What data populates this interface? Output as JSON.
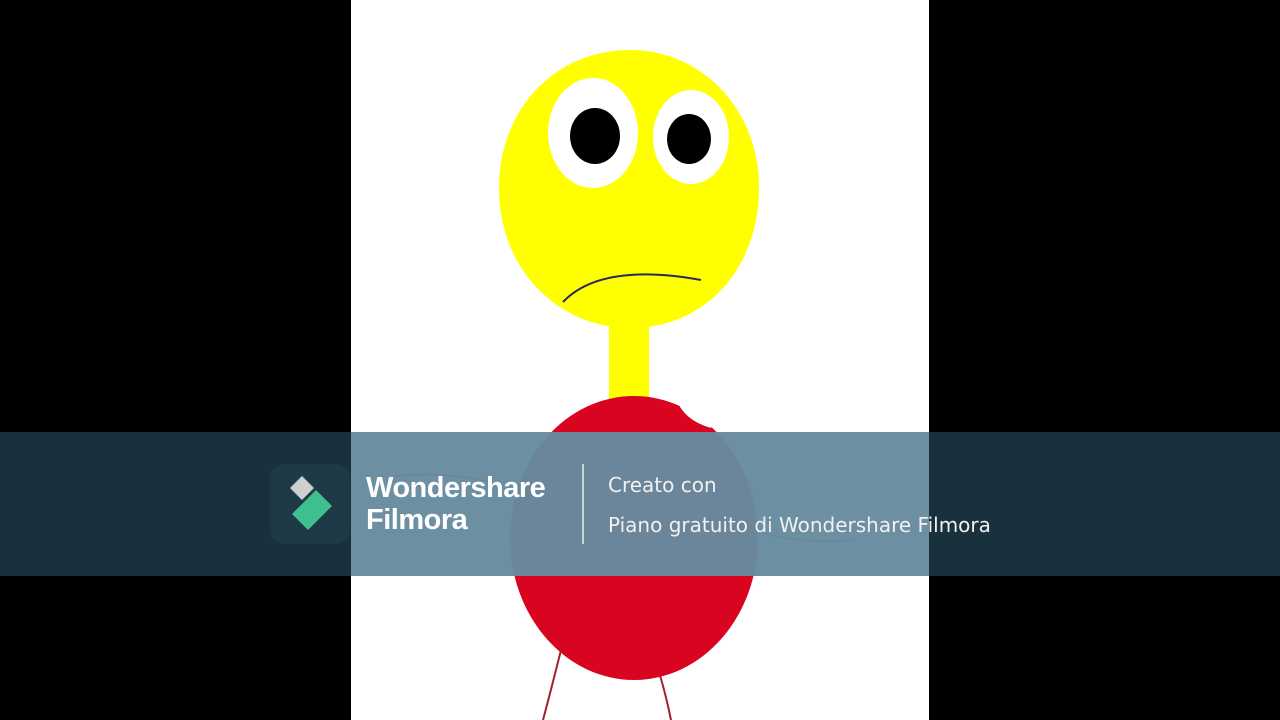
{
  "drawing": {
    "colors": {
      "background": "#000000",
      "paper": "#ffffff",
      "head": "#ffff00",
      "body": "#d90520",
      "eye_white": "#ffffff",
      "pupil": "#000000",
      "mouth": "#2a2a5a",
      "arms": "#55557a",
      "legs": "#a02030"
    },
    "expression": "sad"
  },
  "watermark": {
    "brand_line1": "Wondershare",
    "brand_line2": "Filmora",
    "created_with": "Creato con",
    "plan": "Piano gratuito di Wondershare Filmora",
    "logo_icon": "filmora-logo-icon",
    "colors": {
      "band": "#1b3442",
      "logo_light": "#cfcfcf",
      "logo_green": "#3fbf8f"
    }
  }
}
